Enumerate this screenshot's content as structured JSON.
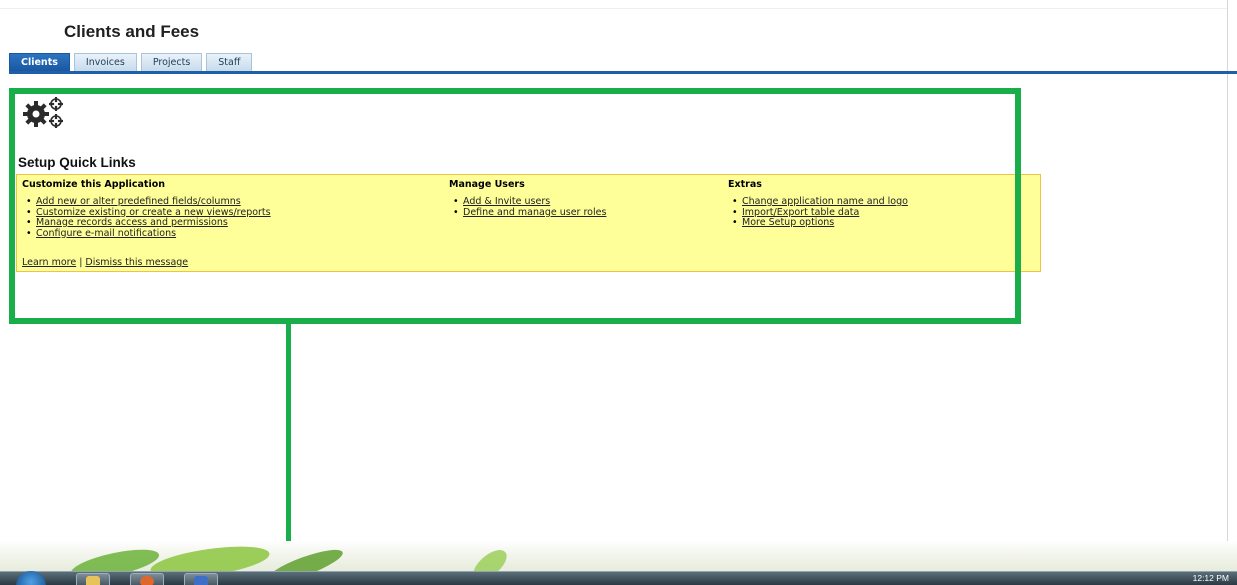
{
  "app": {
    "title": "Clients and Fees"
  },
  "tabs": [
    {
      "label": "Clients",
      "active": true
    },
    {
      "label": "Invoices",
      "active": false
    },
    {
      "label": "Projects",
      "active": false
    },
    {
      "label": "Staff",
      "active": false
    }
  ],
  "setup": {
    "icon": "gears-icon",
    "title": "Setup Quick Links",
    "columns": [
      {
        "heading": "Customize this Application",
        "links": [
          "Add new or alter predefined fields/columns",
          "Customize existing or create a new views/reports",
          "Manage records access and permissions",
          "Configure e-mail notifications"
        ]
      },
      {
        "heading": "Manage Users",
        "links": [
          "Add & Invite users",
          "Define and manage user roles"
        ]
      },
      {
        "heading": "Extras",
        "links": [
          "Change application name and logo",
          "Import/Export table data",
          "More Setup options"
        ]
      }
    ],
    "footer": {
      "learn_more": "Learn more",
      "separator": "|",
      "dismiss": "Dismiss this message"
    }
  },
  "taskbar": {
    "clock": "12:12 PM"
  },
  "colors": {
    "highlight": "#1aae4b",
    "quick_links_bg": "#ffff99",
    "active_tab": "#1a57a1"
  }
}
